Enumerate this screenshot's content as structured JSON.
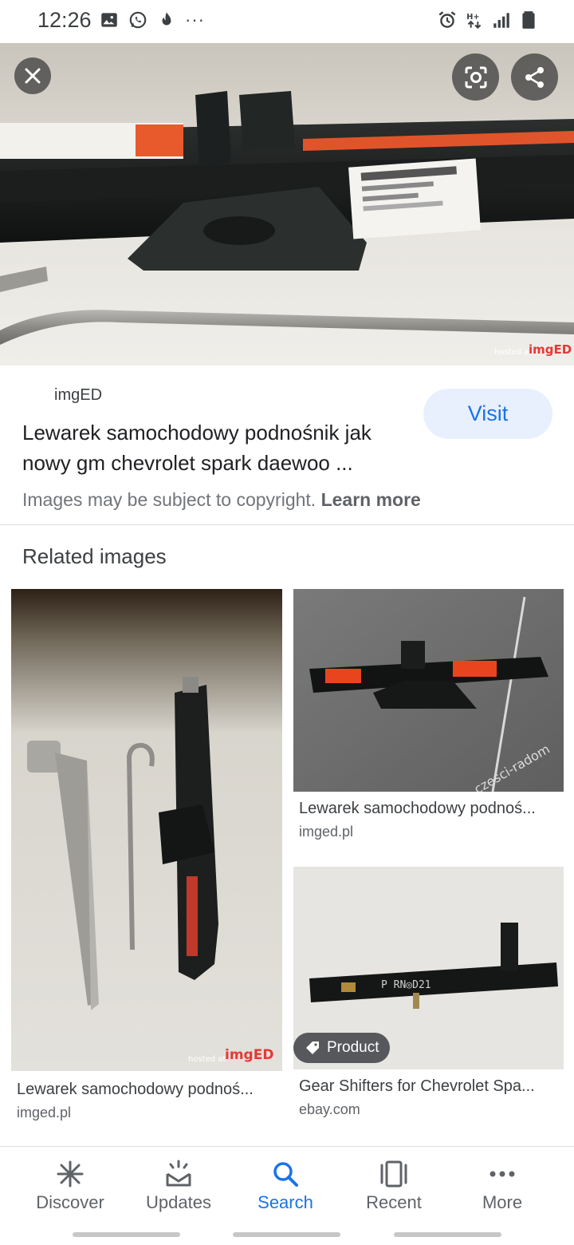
{
  "status_bar": {
    "time": "12:26",
    "left_icons": [
      "image-icon",
      "whatsapp-icon",
      "fire-icon"
    ],
    "more": "···",
    "right_icons": [
      "alarm-icon",
      "network-icon",
      "signal-icon",
      "battery-icon"
    ]
  },
  "hero": {
    "watermark": "imgED",
    "close_icon": "close-icon",
    "lens_icon": "lens-icon",
    "share_icon": "share-icon"
  },
  "result": {
    "source": "imgED",
    "title": "Lewarek samochodowy podnośnik jak nowy gm chevrolet spark daewoo ...",
    "visit_label": "Visit",
    "copyright_text": "Images may be subject to copyright.",
    "learn_more": "Learn more"
  },
  "related": {
    "heading": "Related images",
    "items": [
      {
        "title": "Lewarek samochodowy podnoś...",
        "domain": "imged.pl"
      },
      {
        "title": "Lewarek samochodowy podnoś...",
        "domain": "imged.pl"
      },
      {
        "title": "Gear Shifters for Chevrolet Spa...",
        "domain": "ebay.com",
        "badge": "Product"
      }
    ]
  },
  "bottom_nav": {
    "items": [
      {
        "label": "Discover",
        "icon": "asterisk-icon"
      },
      {
        "label": "Updates",
        "icon": "updates-icon"
      },
      {
        "label": "Search",
        "icon": "search-icon",
        "active": true
      },
      {
        "label": "Recent",
        "icon": "recent-icon"
      },
      {
        "label": "More",
        "icon": "more-icon"
      }
    ]
  },
  "colors": {
    "accent": "#1a73e8",
    "visit_bg": "#e8f0fe",
    "text_primary": "#202124",
    "text_secondary": "#5f6368"
  }
}
